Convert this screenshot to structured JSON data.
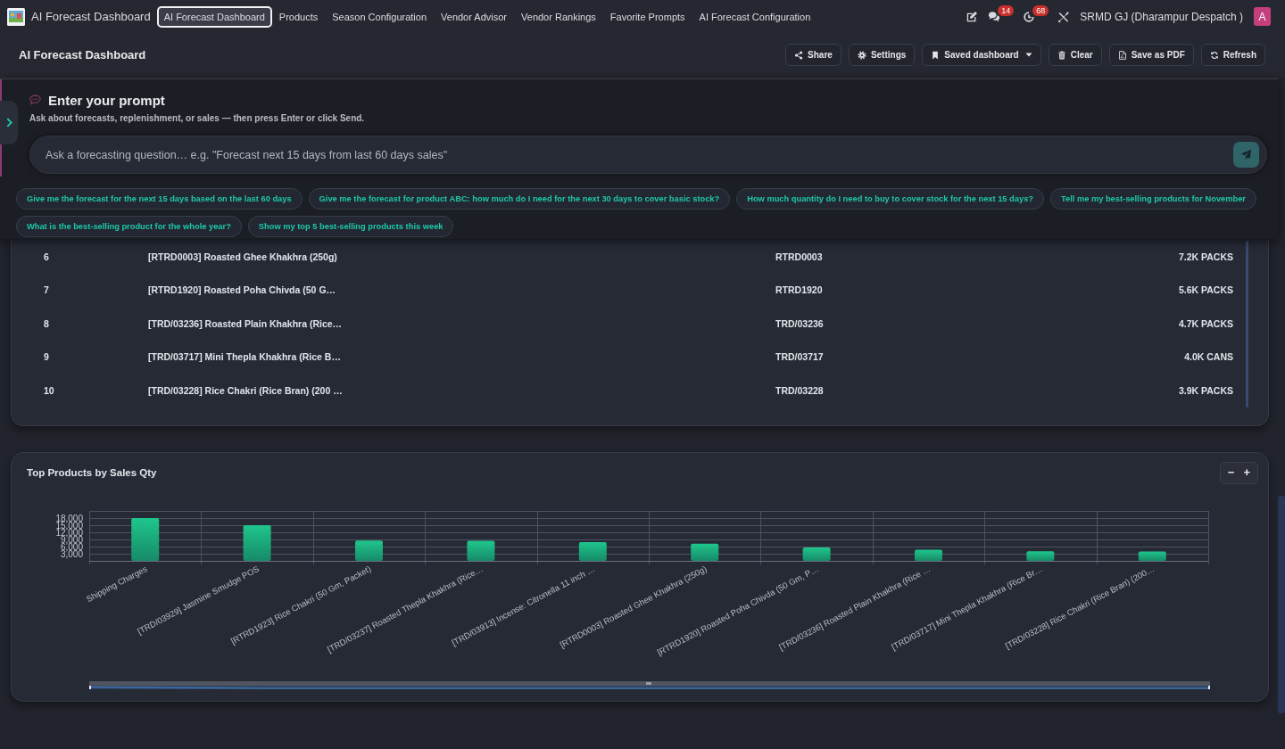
{
  "navbar": {
    "app_title": "AI Forecast Dashboard",
    "menu": [
      {
        "label": "AI Forecast Dashboard",
        "selected": true
      },
      {
        "label": "Products",
        "selected": false
      },
      {
        "label": "Season Configuration",
        "selected": false
      },
      {
        "label": "Vendor Advisor",
        "selected": false
      },
      {
        "label": "Vendor Rankings",
        "selected": false
      },
      {
        "label": "Favorite Prompts",
        "selected": false
      },
      {
        "label": "AI Forecast Configuration",
        "selected": false
      }
    ],
    "systray": [
      {
        "kind": "edit"
      },
      {
        "kind": "messages",
        "count": "14"
      },
      {
        "kind": "activities",
        "count": "68"
      },
      {
        "kind": "tools"
      }
    ],
    "company": "SRMD GJ (Dharampur Despatch )",
    "avatar": "A"
  },
  "header": {
    "title": "AI Forecast Dashboard",
    "actions": [
      {
        "kind": "share",
        "label": "Share",
        "dropdown": false
      },
      {
        "kind": "settings",
        "label": "Settings",
        "dropdown": false
      },
      {
        "kind": "saved",
        "label": "Saved dashboard",
        "dropdown": true
      },
      {
        "kind": "clear",
        "label": "Clear",
        "dropdown": false
      },
      {
        "kind": "pdf",
        "label": "Save as PDF",
        "dropdown": false
      },
      {
        "kind": "refresh",
        "label": "Refresh",
        "dropdown": false
      }
    ]
  },
  "prompt_panel": {
    "sidebar_toggle": {
      "expanded": false
    },
    "title": "Enter your prompt",
    "subtitle": "Ask about forecasts, replenishment, or sales — then press Enter or click Send.",
    "input": {
      "placeholder": "Ask a forecasting question… e.g. \"Forecast next 15 days from last 60 days sales\""
    },
    "suggestions": [
      "Give me the forecast for the next 15 days based on the last 60 days",
      "Give me the forecast for product ABC: how much do I need for the next 30 days to cover basic stock?",
      "How much quantity do I need to buy to cover stock for the next 15 days?",
      "Tell me my best-selling products for November",
      "What is the best-selling product for the whole year?",
      "Show my top 5 best-selling products this week"
    ]
  },
  "top_products_table": {
    "rows": [
      [
        "6",
        "[RTRD0003] Roasted Ghee Khakhra (250g)",
        "RTRD0003",
        "7.2K PACKS"
      ],
      [
        "7",
        "[RTRD1920] Roasted Poha Chivda (50 G…",
        "RTRD1920",
        "5.6K PACKS"
      ],
      [
        "8",
        "[TRD/03236] Roasted Plain Khakhra (Rice…",
        "TRD/03236",
        "4.7K PACKS"
      ],
      [
        "9",
        "[TRD/03717] Mini Thepla Khakhra (Rice B…",
        "TRD/03717",
        "4.0K CANS"
      ],
      [
        "10",
        "[TRD/03228] Rice Chakri (Rice Bran) (200 …",
        "TRD/03228",
        "3.9K PACKS"
      ]
    ]
  },
  "sales_chart": {
    "title": "Top Products by Sales Qty",
    "zoom_controls": [
      "−",
      "+"
    ],
    "chart_data": {
      "type": "bar",
      "grid": true,
      "categories": [
        "Shipping Charges",
        "[TRD/03929] Jasmine Smudge POS",
        "[RTRD1923] Rice Chakri (50 Gm, Packet)",
        "[TRD/03237] Roasted Thepla Khakhra (Rice…",
        "[TRD/03913] Incense: Citronella 11 inch …",
        "[RTRD0003] Roasted Ghee Khakhra (250g)",
        "[RTRD1920] Roasted Poha Chivda (50 Gm, P…",
        "[TRD/03236] Roasted Plain Khakhra (Rice …",
        "[TRD/03717] Mini Thepla Khakhra (Rice Br…",
        "[TRD/03228] Rice Chakri (Rice Bran) (200…"
      ],
      "values": [
        18000,
        15000,
        8500,
        8400,
        7900,
        7200,
        5600,
        4700,
        4000,
        3900
      ],
      "ylim": [
        0,
        21000
      ],
      "yticks": [
        {
          "value": 3000,
          "label": "3,000"
        },
        {
          "value": 6000,
          "label": "6,000"
        },
        {
          "value": 9000,
          "label": "9,000"
        },
        {
          "value": 12000,
          "label": "12,000"
        },
        {
          "value": 15000,
          "label": "15,000"
        },
        {
          "value": 18000,
          "label": "18,000"
        }
      ]
    }
  }
}
